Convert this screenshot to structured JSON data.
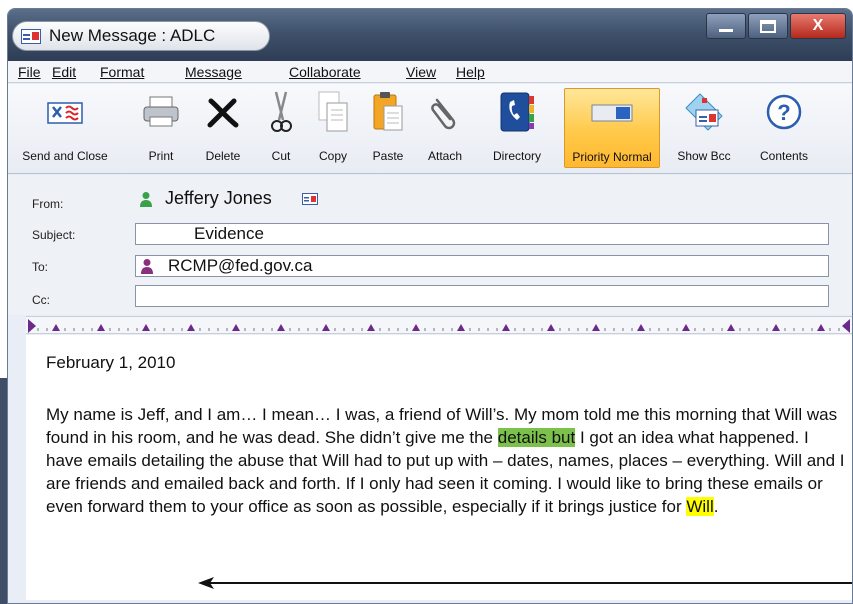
{
  "window": {
    "title": "New Message : ADLC",
    "controls": {
      "close_label": "X"
    }
  },
  "menu": [
    {
      "label": "File"
    },
    {
      "label": "Edit"
    },
    {
      "label": "Format"
    },
    {
      "label": "Message"
    },
    {
      "label": "Collaborate"
    },
    {
      "label": "View"
    },
    {
      "label": "Help"
    }
  ],
  "toolbar": [
    {
      "label": "Send and Close",
      "icon": "send-close-icon"
    },
    {
      "label": "Print",
      "icon": "printer-icon"
    },
    {
      "label": "Delete",
      "icon": "delete-x-icon"
    },
    {
      "label": "Cut",
      "icon": "scissors-icon"
    },
    {
      "label": "Copy",
      "icon": "copy-icon"
    },
    {
      "label": "Paste",
      "icon": "clipboard-icon"
    },
    {
      "label": "Attach",
      "icon": "paperclip-icon"
    },
    {
      "label": "Directory",
      "icon": "phone-book-icon"
    },
    {
      "label": "Priority Normal",
      "icon": "priority-icon",
      "active": true
    },
    {
      "label": "Show Bcc",
      "icon": "show-bcc-icon"
    },
    {
      "label": "Contents",
      "icon": "help-icon"
    }
  ],
  "fields": {
    "from_label": "From:",
    "from_value": "Jeffery Jones",
    "subject_label": "Subject:",
    "subject_value": "Evidence",
    "to_label": "To:",
    "to_value": "RCMP@fed.gov.ca",
    "cc_label": "Cc:",
    "cc_value": ""
  },
  "message": {
    "date": "February 1, 2010",
    "body_before_green": "My name is Jeff, and I am… I mean… I was, a friend of Will’s. My mom told me this morning that Will was found in his room, and he was dead. She didn’t give me the ",
    "highlight_green": "details but",
    "body_middle": " I got an idea what happened. I have emails detailing the abuse that Will had to put up with – dates, names, places – everything. Will and I are friends and emailed back and forth. If I only had seen it coming. I would like to bring these emails or even forward them to your office as soon as possible, especially if it brings justice for ",
    "highlight_yellow": "Will",
    "body_end": "."
  },
  "colors": {
    "accent_active": "#ffc94a",
    "highlight_green": "#7dc14d",
    "highlight_yellow": "#ffff00",
    "ruler_marker": "#6b2a8a"
  }
}
